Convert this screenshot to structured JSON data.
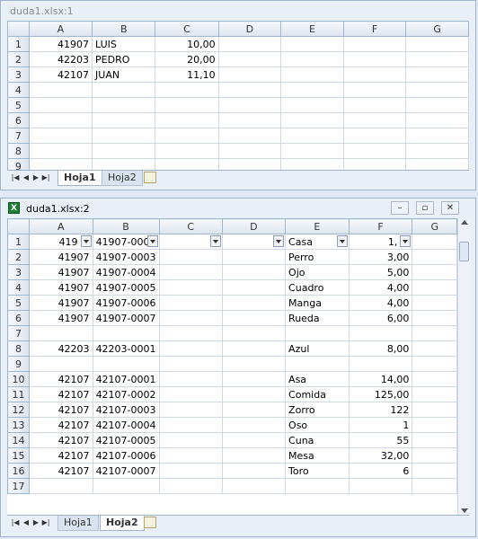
{
  "window1": {
    "title": "duda1.xlsx:1",
    "columns": [
      "A",
      "B",
      "C",
      "D",
      "E",
      "F",
      "G"
    ],
    "rows": [
      {
        "n": "1",
        "a": "41907",
        "b": "LUIS",
        "c": "10,00"
      },
      {
        "n": "2",
        "a": "42203",
        "b": "PEDRO",
        "c": "20,00"
      },
      {
        "n": "3",
        "a": "42107",
        "b": "JUAN",
        "c": "11,10"
      },
      {
        "n": "4",
        "a": "",
        "b": "",
        "c": ""
      },
      {
        "n": "5",
        "a": "",
        "b": "",
        "c": ""
      },
      {
        "n": "6",
        "a": "",
        "b": "",
        "c": ""
      },
      {
        "n": "7",
        "a": "",
        "b": "",
        "c": ""
      },
      {
        "n": "8",
        "a": "",
        "b": "",
        "c": ""
      },
      {
        "n": "9",
        "a": "",
        "b": "",
        "c": ""
      }
    ],
    "tabs": {
      "active": "Hoja1",
      "other": "Hoja2"
    }
  },
  "window2": {
    "title": "duda1.xlsx:2",
    "columns": [
      "A",
      "B",
      "C",
      "D",
      "E",
      "F",
      "G"
    ],
    "header_row": {
      "n": "1",
      "a": "419",
      "b": "41907-000",
      "e": "Casa",
      "f": "1,"
    },
    "rows": [
      {
        "n": "2",
        "a": "41907",
        "b": "41907-0003",
        "e": "Perro",
        "f": "3,00"
      },
      {
        "n": "3",
        "a": "41907",
        "b": "41907-0004",
        "e": "Ojo",
        "f": "5,00"
      },
      {
        "n": "4",
        "a": "41907",
        "b": "41907-0005",
        "e": "Cuadro",
        "f": "4,00"
      },
      {
        "n": "5",
        "a": "41907",
        "b": "41907-0006",
        "e": "Manga",
        "f": "4,00"
      },
      {
        "n": "6",
        "a": "41907",
        "b": "41907-0007",
        "e": "Rueda",
        "f": "6,00"
      },
      {
        "n": "7",
        "a": "",
        "b": "",
        "e": "",
        "f": ""
      },
      {
        "n": "8",
        "a": "42203",
        "b": "42203-0001",
        "e": "Azul",
        "f": "8,00"
      },
      {
        "n": "9",
        "a": "",
        "b": "",
        "e": "",
        "f": ""
      },
      {
        "n": "10",
        "a": "42107",
        "b": "42107-0001",
        "e": "Asa",
        "f": "14,00"
      },
      {
        "n": "11",
        "a": "42107",
        "b": "42107-0002",
        "e": "Comida",
        "f": "125,00"
      },
      {
        "n": "12",
        "a": "42107",
        "b": "42107-0003",
        "e": "Zorro",
        "f": "122"
      },
      {
        "n": "13",
        "a": "42107",
        "b": "42107-0004",
        "e": "Oso",
        "f": "1"
      },
      {
        "n": "14",
        "a": "42107",
        "b": "42107-0005",
        "e": "Cuna",
        "f": "55"
      },
      {
        "n": "15",
        "a": "42107",
        "b": "42107-0006",
        "e": "Mesa",
        "f": "32,00"
      },
      {
        "n": "16",
        "a": "42107",
        "b": "42107-0007",
        "e": "Toro",
        "f": "6"
      },
      {
        "n": "17",
        "a": "",
        "b": "",
        "e": "",
        "f": ""
      }
    ],
    "tabs": {
      "active": "Hoja2",
      "other": "Hoja1"
    },
    "controls": {
      "minimize": "–",
      "restore": "▫",
      "close": "✕"
    }
  }
}
